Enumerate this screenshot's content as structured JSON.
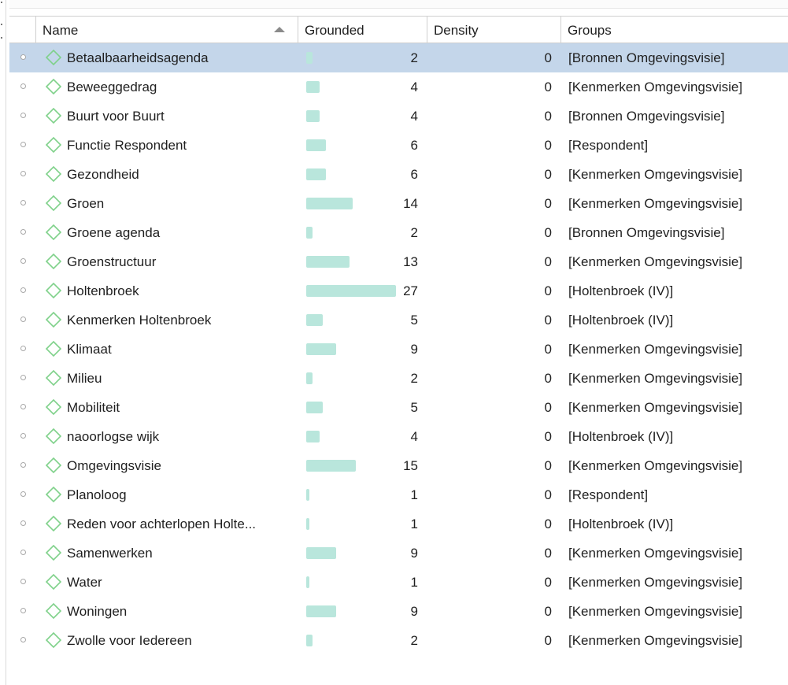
{
  "columns": {
    "name": "Name",
    "grounded": "Grounded",
    "density": "Density",
    "groups": "Groups"
  },
  "colors": {
    "selection": "#c4d6ea",
    "bar": "#b9e6dc",
    "code_icon": "#7fd18a"
  },
  "rows": [
    {
      "name": "Betaalbaarheidsagenda",
      "grounded": 2,
      "density": 0,
      "groups": "[Bronnen Omgevingsvisie]",
      "selected": true
    },
    {
      "name": "Beweeggedrag",
      "grounded": 4,
      "density": 0,
      "groups": "[Kenmerken Omgevingsvisie]"
    },
    {
      "name": "Buurt voor Buurt",
      "grounded": 4,
      "density": 0,
      "groups": "[Bronnen Omgevingsvisie]"
    },
    {
      "name": "Functie Respondent",
      "grounded": 6,
      "density": 0,
      "groups": "[Respondent]"
    },
    {
      "name": "Gezondheid",
      "grounded": 6,
      "density": 0,
      "groups": "[Kenmerken Omgevingsvisie]"
    },
    {
      "name": "Groen",
      "grounded": 14,
      "density": 0,
      "groups": "[Kenmerken Omgevingsvisie]"
    },
    {
      "name": "Groene agenda",
      "grounded": 2,
      "density": 0,
      "groups": "[Bronnen Omgevingsvisie]"
    },
    {
      "name": "Groenstructuur",
      "grounded": 13,
      "density": 0,
      "groups": "[Kenmerken Omgevingsvisie]"
    },
    {
      "name": "Holtenbroek",
      "grounded": 27,
      "density": 0,
      "groups": "[Holtenbroek (IV)]"
    },
    {
      "name": "Kenmerken Holtenbroek",
      "grounded": 5,
      "density": 0,
      "groups": "[Holtenbroek (IV)]"
    },
    {
      "name": "Klimaat",
      "grounded": 9,
      "density": 0,
      "groups": "[Kenmerken Omgevingsvisie]"
    },
    {
      "name": "Milieu",
      "grounded": 2,
      "density": 0,
      "groups": "[Kenmerken Omgevingsvisie]"
    },
    {
      "name": "Mobiliteit",
      "grounded": 5,
      "density": 0,
      "groups": "[Kenmerken Omgevingsvisie]"
    },
    {
      "name": "naoorlogse wijk",
      "grounded": 4,
      "density": 0,
      "groups": "[Holtenbroek (IV)]"
    },
    {
      "name": "Omgevingsvisie",
      "grounded": 15,
      "density": 0,
      "groups": "[Kenmerken Omgevingsvisie]"
    },
    {
      "name": "Planoloog",
      "grounded": 1,
      "density": 0,
      "groups": "[Respondent]"
    },
    {
      "name": "Reden voor achterlopen Holte...",
      "grounded": 1,
      "density": 0,
      "groups": "[Holtenbroek (IV)]"
    },
    {
      "name": "Samenwerken",
      "grounded": 9,
      "density": 0,
      "groups": "[Kenmerken Omgevingsvisie]"
    },
    {
      "name": "Water",
      "grounded": 1,
      "density": 0,
      "groups": "[Kenmerken Omgevingsvisie]"
    },
    {
      "name": "Woningen",
      "grounded": 9,
      "density": 0,
      "groups": "[Kenmerken Omgevingsvisie]"
    },
    {
      "name": "Zwolle voor Iedereen",
      "grounded": 2,
      "density": 0,
      "groups": "[Kenmerken Omgevingsvisie]"
    }
  ]
}
